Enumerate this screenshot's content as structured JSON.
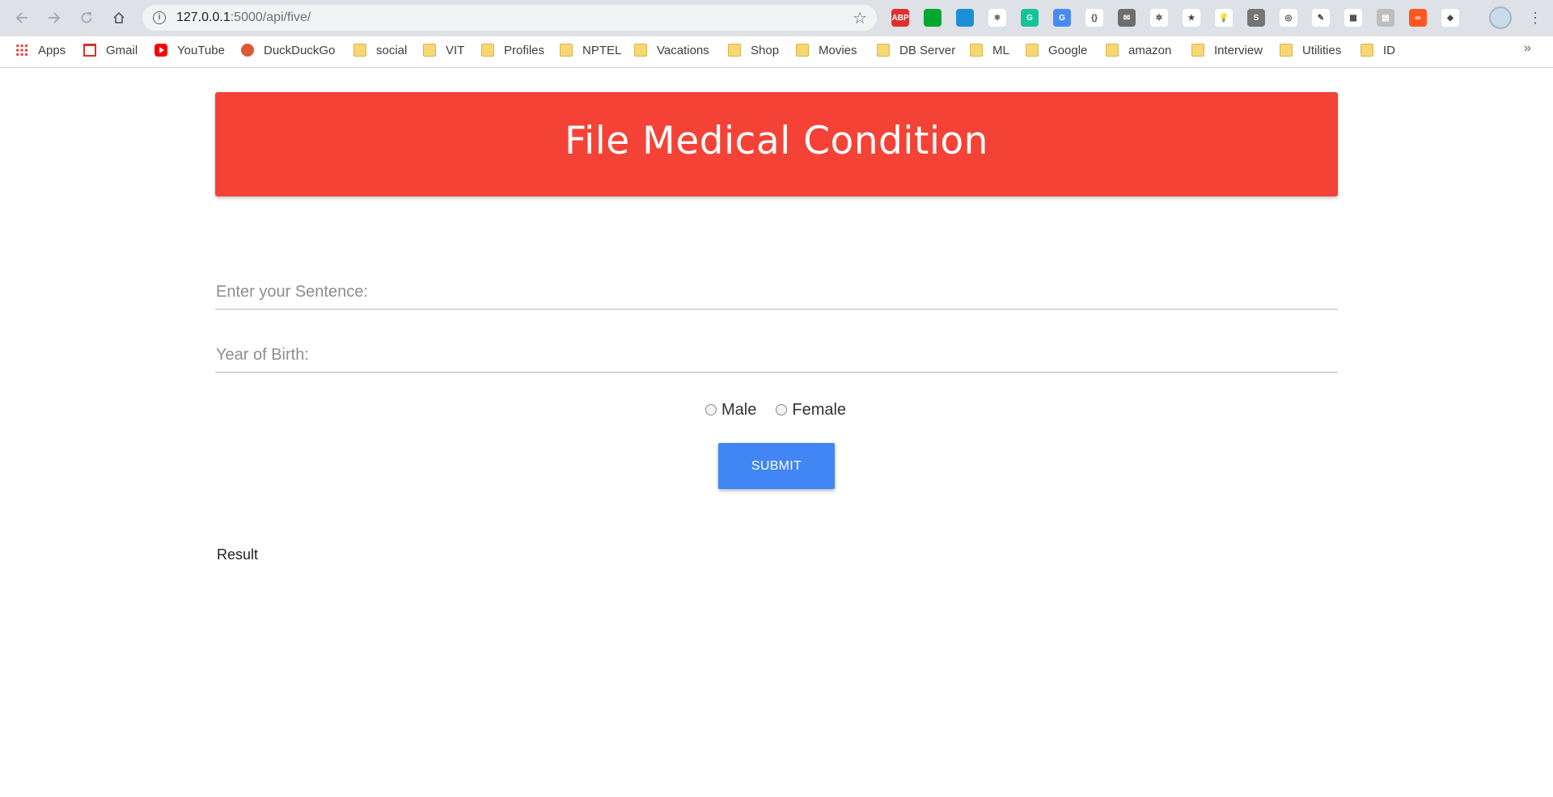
{
  "browser": {
    "url_host": "127.0.0.1",
    "url_rest": ":5000/api/five/",
    "extensions": [
      {
        "name": "adblock-plus-icon",
        "text": "ABP",
        "color": "#e02f2f"
      },
      {
        "name": "evernote-icon",
        "text": "",
        "color": "#00a82d"
      },
      {
        "name": "tab-icon",
        "text": "",
        "color": "#1a8fd6"
      },
      {
        "name": "react-devtools-icon",
        "text": "⚛",
        "color": "#ffffff"
      },
      {
        "name": "grammarly-icon",
        "text": "G",
        "color": "#15c39a"
      },
      {
        "name": "google-translate-icon",
        "text": "G",
        "color": "#4a8af4"
      },
      {
        "name": "json-viewer-icon",
        "text": "{}",
        "color": "#ffffff"
      },
      {
        "name": "mail-extension-icon",
        "text": "✉",
        "color": "#6d6d6d"
      },
      {
        "name": "settings-extension-icon",
        "text": "✲",
        "color": "#ffffff"
      },
      {
        "name": "star-extension-icon",
        "text": "★",
        "color": "#ffffff"
      },
      {
        "name": "bulb-extension-icon",
        "text": "💡",
        "color": "#ffffff"
      },
      {
        "name": "s-extension-icon",
        "text": "S",
        "color": "#757575"
      },
      {
        "name": "sync-extension-icon",
        "text": "◎",
        "color": "#ffffff"
      },
      {
        "name": "pen-extension-icon",
        "text": "✎",
        "color": "#ffffff"
      },
      {
        "name": "chart-extension-icon",
        "text": "▦",
        "color": "#ffffff"
      },
      {
        "name": "box-extension-icon",
        "text": "▤",
        "color": "#bdbdbd"
      },
      {
        "name": "infinity-extension-icon",
        "text": "∞",
        "color": "#ff5722"
      },
      {
        "name": "octocat-extension-icon",
        "text": "◆",
        "color": "#ffffff"
      }
    ]
  },
  "bookmarks": [
    {
      "label": "Apps",
      "icon": "apps"
    },
    {
      "label": "Gmail",
      "icon": "gmail"
    },
    {
      "label": "YouTube",
      "icon": "youtube"
    },
    {
      "label": "DuckDuckGo",
      "icon": "duckduckgo"
    },
    {
      "label": "social",
      "icon": "folder"
    },
    {
      "label": "VIT",
      "icon": "folder"
    },
    {
      "label": "Profiles",
      "icon": "folder"
    },
    {
      "label": "NPTEL",
      "icon": "folder"
    },
    {
      "label": "Vacations",
      "icon": "folder"
    },
    {
      "label": "Shop",
      "icon": "folder"
    },
    {
      "label": "Movies",
      "icon": "folder"
    },
    {
      "label": "DB Server",
      "icon": "folder"
    },
    {
      "label": "ML",
      "icon": "folder"
    },
    {
      "label": "Google",
      "icon": "folder"
    },
    {
      "label": "amazon",
      "icon": "folder"
    },
    {
      "label": "Interview",
      "icon": "folder"
    },
    {
      "label": "Utilities",
      "icon": "folder"
    },
    {
      "label": "ID",
      "icon": "folder"
    }
  ],
  "page": {
    "title": "File Medical Condition",
    "sentence_placeholder": "Enter your Sentence:",
    "sentence_value": "",
    "yob_placeholder": "Year of Birth:",
    "yob_value": "",
    "gender_options": [
      "Male",
      "Female"
    ],
    "submit_label": "SUBMIT",
    "result_label": "Result"
  },
  "colors": {
    "header_bg": "#f44336",
    "submit_bg": "#4285f4"
  }
}
